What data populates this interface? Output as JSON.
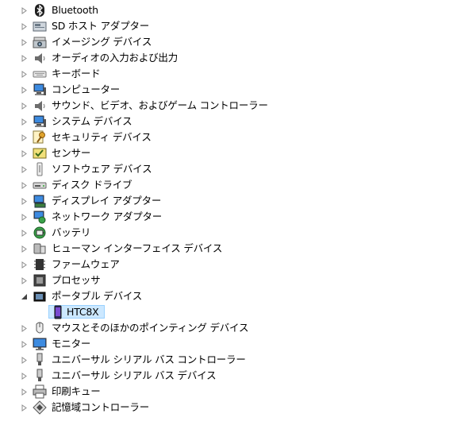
{
  "tree": {
    "items": [
      {
        "label": "Bluetooth",
        "icon": "bluetooth-icon",
        "expanded": false
      },
      {
        "label": "SD ホスト アダプター",
        "icon": "sd-host-adapter-icon",
        "expanded": false
      },
      {
        "label": "イメージング デバイス",
        "icon": "imaging-device-icon",
        "expanded": false
      },
      {
        "label": "オーディオの入力および出力",
        "icon": "audio-io-icon",
        "expanded": false
      },
      {
        "label": "キーボード",
        "icon": "keyboard-icon",
        "expanded": false
      },
      {
        "label": "コンピューター",
        "icon": "computer-icon",
        "expanded": false
      },
      {
        "label": "サウンド、ビデオ、およびゲーム コントローラー",
        "icon": "sound-video-game-icon",
        "expanded": false
      },
      {
        "label": "システム デバイス",
        "icon": "system-device-icon",
        "expanded": false
      },
      {
        "label": "セキュリティ デバイス",
        "icon": "security-device-icon",
        "expanded": false
      },
      {
        "label": "センサー",
        "icon": "sensor-icon",
        "expanded": false
      },
      {
        "label": "ソフトウェア デバイス",
        "icon": "software-device-icon",
        "expanded": false
      },
      {
        "label": "ディスク ドライブ",
        "icon": "disk-drive-icon",
        "expanded": false
      },
      {
        "label": "ディスプレイ アダプター",
        "icon": "display-adapter-icon",
        "expanded": false
      },
      {
        "label": "ネットワーク アダプター",
        "icon": "network-adapter-icon",
        "expanded": false
      },
      {
        "label": "バッテリ",
        "icon": "battery-icon",
        "expanded": false
      },
      {
        "label": "ヒューマン インターフェイス デバイス",
        "icon": "hid-icon",
        "expanded": false
      },
      {
        "label": "ファームウェア",
        "icon": "firmware-icon",
        "expanded": false
      },
      {
        "label": "プロセッサ",
        "icon": "processor-icon",
        "expanded": false
      },
      {
        "label": "ポータブル デバイス",
        "icon": "portable-device-icon",
        "expanded": true
      },
      {
        "label": "HTC8X",
        "icon": "phone-icon",
        "child": true,
        "selected": true
      },
      {
        "label": "マウスとそのほかのポインティング デバイス",
        "icon": "mouse-icon",
        "expanded": false
      },
      {
        "label": "モニター",
        "icon": "monitor-icon",
        "expanded": false
      },
      {
        "label": "ユニバーサル シリアル バス コントローラー",
        "icon": "usb-controller-icon",
        "expanded": false
      },
      {
        "label": "ユニバーサル シリアル バス デバイス",
        "icon": "usb-device-icon",
        "expanded": false
      },
      {
        "label": "印刷キュー",
        "icon": "print-queue-icon",
        "expanded": false
      },
      {
        "label": "記憶域コントローラー",
        "icon": "storage-controller-icon",
        "expanded": false
      }
    ]
  },
  "colors": {
    "selection_bg": "#cce8ff",
    "selection_border": "#99d1ff",
    "arrow": "#8c8c8c"
  }
}
